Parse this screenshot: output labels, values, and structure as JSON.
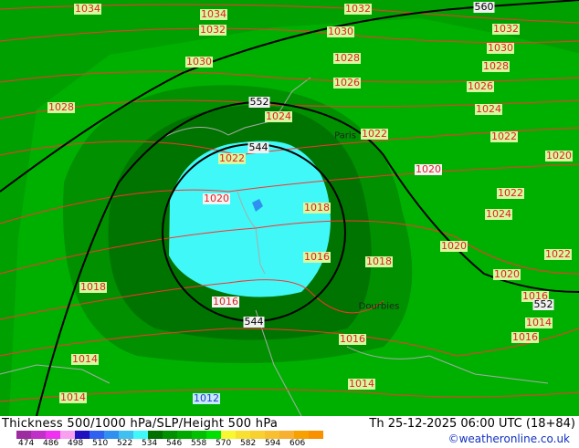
{
  "title": "Thickness 500/1000 hPa/SLP/Height 500 hPa",
  "valid_time": "Th 25-12-2025 06:00 UTC (18+84)",
  "credit": "©weatheronline.co.uk",
  "legend": {
    "ticks": [
      "474",
      "486",
      "498",
      "510",
      "522",
      "534",
      "546",
      "558",
      "570",
      "582",
      "594",
      "606"
    ],
    "colors": [
      "#9c2ca0",
      "#c030c8",
      "#f030f0",
      "#f8a0f0",
      "#2010c0",
      "#3060f0",
      "#3090f0",
      "#40c0f0",
      "#40f8f8",
      "#007000",
      "#009000",
      "#00a800",
      "#00c000",
      "#00e000",
      "#f8f830",
      "#f8e030",
      "#f8d030",
      "#f8c030",
      "#f8b030",
      "#f8a000",
      "#f89000"
    ]
  },
  "isobar_labels": [
    "1034",
    "1034",
    "1032",
    "1032",
    "1030",
    "1032",
    "1030",
    "1030",
    "1028",
    "1028",
    "1026",
    "1026",
    "1028",
    "1024",
    "1024",
    "1022",
    "1022",
    "1022",
    "1020",
    "1020",
    "1022",
    "1020",
    "1018",
    "1024",
    "1020",
    "1016",
    "1018",
    "1022",
    "1020",
    "1018",
    "1016",
    "1016",
    "1014",
    "1016",
    "1016",
    "1014",
    "1014",
    "1014",
    "1012"
  ],
  "height_labels": [
    "560",
    "552",
    "544",
    "552",
    "544"
  ],
  "cities": [
    "Paris",
    "Dourbies"
  ],
  "colors": {
    "thickness_534": "#007000",
    "thickness_546": "#009000",
    "thickness_558": "#00a800",
    "thickness_522": "#40f8f8",
    "isobar": "#ff3030",
    "height": "#000000"
  }
}
